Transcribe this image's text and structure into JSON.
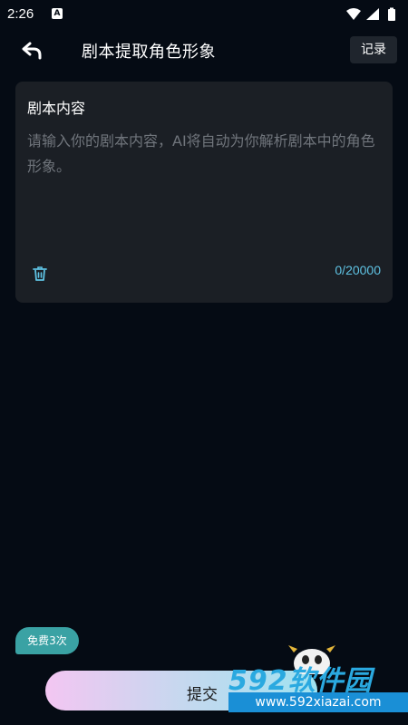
{
  "status_bar": {
    "time": "2:26",
    "notification_icon": "a-icon",
    "icons": [
      "wifi-icon",
      "signal-icon",
      "battery-icon"
    ]
  },
  "header": {
    "title": "剧本提取角色形象",
    "record_label": "记录",
    "back_icon": "back-arrow-icon"
  },
  "editor": {
    "title": "剧本内容",
    "placeholder": "请输入你的剧本内容，AI将自动为你解析剧本中的角色形象。",
    "counter": "0/20000",
    "clear_icon": "trash-icon"
  },
  "footer": {
    "free_badge": "免费3次",
    "submit_label": "提交"
  },
  "watermark": {
    "brand": "592软件园",
    "url": "www.592xiazai.com"
  },
  "colors": {
    "background": "#050b14",
    "card": "#1b1f25",
    "counter": "#5fc3e4",
    "badge": "#3aa2a4"
  }
}
